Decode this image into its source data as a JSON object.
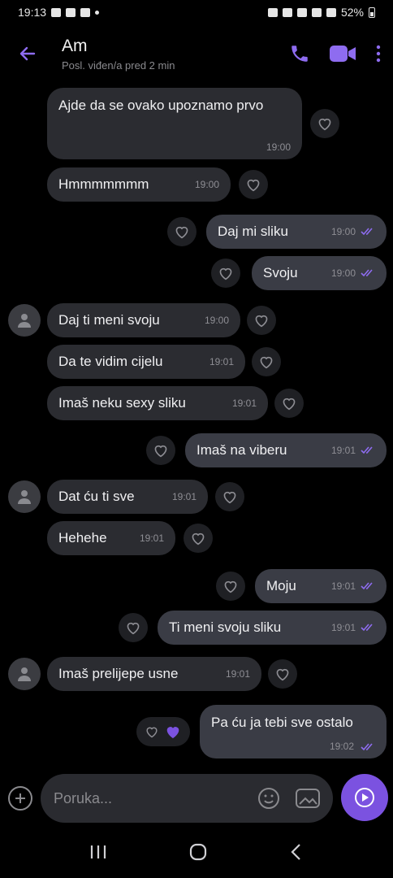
{
  "status_bar": {
    "time": "19:13",
    "battery": "52%"
  },
  "header": {
    "name": "Am",
    "last_seen": "Posl. viđen/a pred 2 min"
  },
  "colors": {
    "accent": "#7b52e0",
    "incoming_bubble": "#2b2c31",
    "outgoing_bubble": "#3a3c45",
    "background": "#000000"
  },
  "messages": [
    {
      "dir": "in",
      "text": "Ajde da se ovako upoznamo prvo",
      "time": "19:00"
    },
    {
      "dir": "in",
      "text": "Hmmmmmmm",
      "time": "19:00"
    },
    {
      "dir": "out",
      "text": "Daj mi sliku",
      "time": "19:00"
    },
    {
      "dir": "out",
      "text": "Svoju",
      "time": "19:00"
    },
    {
      "dir": "in",
      "text": "Daj ti meni svoju",
      "time": "19:00"
    },
    {
      "dir": "in",
      "text": "Da te vidim cijelu",
      "time": "19:01"
    },
    {
      "dir": "in",
      "text": "Imaš neku sexy sliku",
      "time": "19:01"
    },
    {
      "dir": "out",
      "text": "Imaš na viberu",
      "time": "19:01"
    },
    {
      "dir": "in",
      "text": "Dat ću ti sve",
      "time": "19:01"
    },
    {
      "dir": "in",
      "text": "Hehehe",
      "time": "19:01"
    },
    {
      "dir": "out",
      "text": "Moju",
      "time": "19:01"
    },
    {
      "dir": "out",
      "text": "Ti meni svoju sliku",
      "time": "19:01"
    },
    {
      "dir": "in",
      "text": "Imaš prelijepe usne",
      "time": "19:01"
    },
    {
      "dir": "out",
      "text": "Pa ću ja tebi sve ostalo",
      "time": "19:02",
      "liked": true
    }
  ],
  "composer": {
    "placeholder": "Poruka..."
  }
}
